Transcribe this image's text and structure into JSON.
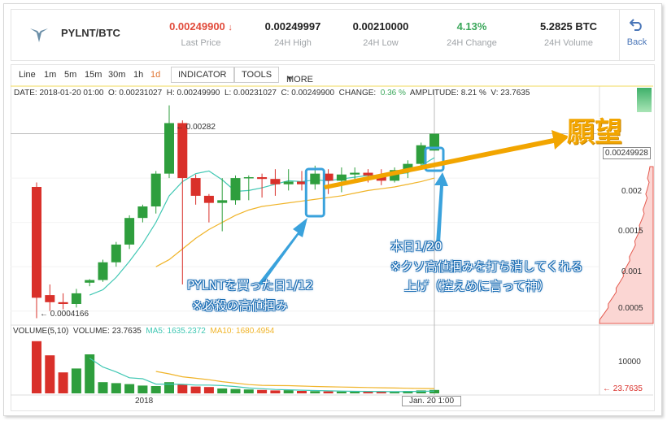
{
  "header": {
    "pair": "PYLNT/BTC",
    "stats": [
      {
        "value": "0.00249900",
        "arrow": "↓",
        "label": "Last Price",
        "tone": "red"
      },
      {
        "value": "0.00249997",
        "label": "24H High",
        "tone": "normal"
      },
      {
        "value": "0.00210000",
        "label": "24H Low",
        "tone": "normal"
      },
      {
        "value": "4.13%",
        "label": "24H Change",
        "tone": "green"
      },
      {
        "value": "5.2825 BTC",
        "label": "24H Volume",
        "tone": "normal"
      }
    ],
    "back_label": "Back"
  },
  "toolbar": {
    "intervals": [
      "Line",
      "1m",
      "5m",
      "15m",
      "30m",
      "1h",
      "1d"
    ],
    "active_interval": "1d",
    "indicator_label": "INDICATOR",
    "tools_label": "TOOLS",
    "more_label": "MORE"
  },
  "info_line": {
    "date": "DATE: 2018-01-20  01:00",
    "open": "O: 0.00231027",
    "high": "H: 0.00249990",
    "low": "L: 0.00231027",
    "close": "C: 0.00249900",
    "change_label": "CHANGE:",
    "change_value": "0.36 %",
    "amplitude": "AMPLITUDE: 8.21 %",
    "vol": "V: 23.7635"
  },
  "volume_line": {
    "title": "VOLUME(5,10)",
    "volume": "VOLUME: 23.7635",
    "ma5": "MA5: 1635.2372",
    "ma10": "MA10: 1680.4954"
  },
  "price_axis": {
    "current": "0.00249928",
    "ticks": [
      "0.002",
      "0.0015",
      "0.001",
      "0.0005"
    ],
    "volume_tick": "10000",
    "volume_current": "23.7635"
  },
  "time_axis": {
    "label_2018": "2018",
    "cursor": "Jan. 20  1:00"
  },
  "markers": {
    "high": "← 0.00282",
    "low": "← 0.0004166"
  },
  "annotations": {
    "wish": "願望",
    "buy_line1": "PYLNTを買った日1/12",
    "buy_line2": "※必殺の高値掴み",
    "today_line1": "本日1/20",
    "today_line2": "※クソ高値掴みを打ち消してくれる",
    "today_line3": "上げ（控えめに言って神）"
  },
  "colors": {
    "up": "#2e9e3d",
    "down": "#d9302a",
    "ma5": "#3fc7b3",
    "ma10": "#f0b429",
    "accent_blue": "#3aa2dc",
    "arrow_orange": "#f2a500"
  },
  "chart_data": {
    "type": "candlestick",
    "candles": [
      {
        "o": 0.0019,
        "h": 0.00195,
        "l": 0.00042,
        "c": 0.00065
      },
      {
        "o": 0.00068,
        "h": 0.0008,
        "l": 0.0005,
        "c": 0.0006
      },
      {
        "o": 0.0006,
        "h": 0.0007,
        "l": 0.00052,
        "c": 0.00058
      },
      {
        "o": 0.00058,
        "h": 0.00075,
        "l": 0.00054,
        "c": 0.0007
      },
      {
        "o": 0.00082,
        "h": 0.00086,
        "l": 0.00078,
        "c": 0.00085
      },
      {
        "o": 0.00085,
        "h": 0.00108,
        "l": 0.00083,
        "c": 0.00105
      },
      {
        "o": 0.00105,
        "h": 0.00128,
        "l": 0.001,
        "c": 0.00125
      },
      {
        "o": 0.00125,
        "h": 0.00158,
        "l": 0.0012,
        "c": 0.00155
      },
      {
        "o": 0.00155,
        "h": 0.0017,
        "l": 0.0015,
        "c": 0.00168
      },
      {
        "o": 0.00168,
        "h": 0.00208,
        "l": 0.0016,
        "c": 0.00205
      },
      {
        "o": 0.00205,
        "h": 0.00282,
        "l": 0.002,
        "c": 0.00262
      },
      {
        "o": 0.00262,
        "h": 0.00265,
        "l": 0.0008,
        "c": 0.002
      },
      {
        "o": 0.002,
        "h": 0.00204,
        "l": 0.0017,
        "c": 0.0018
      },
      {
        "o": 0.0018,
        "h": 0.00182,
        "l": 0.0015,
        "c": 0.00172
      },
      {
        "o": 0.00172,
        "h": 0.002,
        "l": 0.0014,
        "c": 0.00175
      },
      {
        "o": 0.00175,
        "h": 0.00203,
        "l": 0.0017,
        "c": 0.002
      },
      {
        "o": 0.002,
        "h": 0.00203,
        "l": 0.00175,
        "c": 0.00201
      },
      {
        "o": 0.00201,
        "h": 0.00205,
        "l": 0.00178,
        "c": 0.00199
      },
      {
        "o": 0.00199,
        "h": 0.0021,
        "l": 0.0018,
        "c": 0.00193
      },
      {
        "o": 0.00193,
        "h": 0.0021,
        "l": 0.00186,
        "c": 0.00196
      },
      {
        "o": 0.00196,
        "h": 0.00208,
        "l": 0.00186,
        "c": 0.00193
      },
      {
        "o": 0.00193,
        "h": 0.00214,
        "l": 0.00187,
        "c": 0.00205
      },
      {
        "o": 0.00205,
        "h": 0.0021,
        "l": 0.00182,
        "c": 0.00197
      },
      {
        "o": 0.00197,
        "h": 0.00212,
        "l": 0.00184,
        "c": 0.00204
      },
      {
        "o": 0.00204,
        "h": 0.00212,
        "l": 0.00195,
        "c": 0.00206
      },
      {
        "o": 0.00206,
        "h": 0.0021,
        "l": 0.00195,
        "c": 0.00203
      },
      {
        "o": 0.00203,
        "h": 0.0021,
        "l": 0.00192,
        "c": 0.00197
      },
      {
        "o": 0.00197,
        "h": 0.00212,
        "l": 0.00195,
        "c": 0.00209
      },
      {
        "o": 0.00209,
        "h": 0.0022,
        "l": 0.002,
        "c": 0.00216
      },
      {
        "o": 0.00216,
        "h": 0.0024,
        "l": 0.00214,
        "c": 0.00237
      },
      {
        "o": 0.00231,
        "h": 0.0025,
        "l": 0.00231,
        "c": 0.0025
      }
    ],
    "ma5": [
      null,
      null,
      null,
      null,
      0.00068,
      0.00074,
      0.00088,
      0.00106,
      0.00126,
      0.0015,
      0.0018,
      0.00196,
      0.00205,
      0.00208,
      0.00198,
      0.00185,
      0.00186,
      0.00189,
      0.00193,
      0.00197,
      0.00196,
      0.00198,
      0.00197,
      0.00199,
      0.00201,
      0.00203,
      0.00203,
      0.00204,
      0.00206,
      0.00214,
      0.00223
    ],
    "ma10": [
      null,
      null,
      null,
      null,
      null,
      null,
      null,
      null,
      null,
      0.001,
      0.00108,
      0.0012,
      0.00132,
      0.00142,
      0.0015,
      0.00158,
      0.00164,
      0.00168,
      0.0017,
      0.00172,
      0.00174,
      0.00176,
      0.00178,
      0.0018,
      0.00183,
      0.00186,
      0.00188,
      0.0019,
      0.00193,
      0.00196,
      0.002
    ],
    "volumes": [
      10700,
      7800,
      4300,
      5100,
      8000,
      2300,
      2100,
      1900,
      1600,
      1500,
      2300,
      1900,
      1400,
      1300,
      1000,
      900,
      800,
      700,
      600,
      650,
      500,
      450,
      400,
      380,
      360,
      340,
      330,
      400,
      500,
      600,
      700
    ],
    "vol_ma5": [
      null,
      null,
      null,
      null,
      7200,
      5400,
      4400,
      3200,
      3000,
      1900,
      1900,
      1850,
      1700,
      1700,
      1600,
      1400,
      1100,
      950,
      800,
      730,
      650,
      580,
      520,
      470,
      420,
      390,
      370,
      360,
      380,
      420,
      470
    ],
    "vol_ma10": [
      null,
      null,
      null,
      null,
      null,
      null,
      null,
      null,
      null,
      4500,
      4000,
      3400,
      3100,
      2800,
      2400,
      2100,
      1800,
      1650,
      1600,
      1580,
      1500,
      1420,
      1350,
      1300,
      1250,
      1200,
      1150,
      1100,
      1050,
      1000,
      980
    ],
    "price_axis_ticks": [
      0.002,
      0.0015,
      0.001,
      0.0005
    ],
    "price_range": [
      0.00036,
      0.003
    ],
    "volume_range": [
      0,
      11500
    ]
  }
}
